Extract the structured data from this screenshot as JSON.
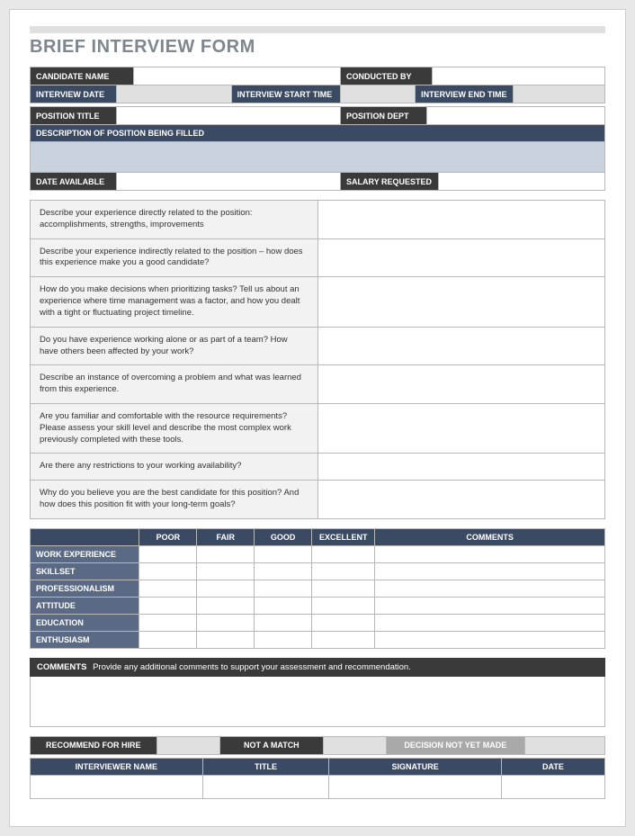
{
  "title": "BRIEF INTERVIEW FORM",
  "header": {
    "candidate_name_label": "CANDIDATE NAME",
    "conducted_by_label": "CONDUCTED BY",
    "interview_date_label": "INTERVIEW DATE",
    "interview_start_label": "INTERVIEW START TIME",
    "interview_end_label": "INTERVIEW END TIME",
    "position_title_label": "POSITION TITLE",
    "position_dept_label": "POSITION DEPT",
    "description_label": "DESCRIPTION OF POSITION BEING FILLED",
    "date_available_label": "DATE AVAILABLE",
    "salary_requested_label": "SALARY REQUESTED"
  },
  "questions": [
    "Describe your experience directly related to the position: accomplishments, strengths, improvements",
    "Describe your experience indirectly related to the position – how does this experience make you a good candidate?",
    "How do you make decisions when prioritizing tasks? Tell us about an experience where time management was a factor, and how you dealt with a tight or fluctuating project timeline.",
    "Do you have experience working alone or as part of a team? How have others been affected by your work?",
    "Describe an instance of overcoming a problem and what was learned from this experience.",
    "Are you familiar and comfortable with the resource requirements? Please assess your skill level and describe the most complex work previously completed with these tools.",
    "Are there any restrictions to your working availability?",
    "Why do you believe you are the best candidate for this position? And how does this position fit with your long-term goals?"
  ],
  "ratings": {
    "columns": [
      "POOR",
      "FAIR",
      "GOOD",
      "EXCELLENT",
      "COMMENTS"
    ],
    "rows": [
      "WORK EXPERIENCE",
      "SKILLSET",
      "PROFESSIONALISM",
      "ATTITUDE",
      "EDUCATION",
      "ENTHUSIASM"
    ]
  },
  "comments": {
    "label": "COMMENTS",
    "text": "Provide any additional comments to support your assessment and recommendation."
  },
  "decision": {
    "recommend_label": "RECOMMEND FOR HIRE",
    "not_match_label": "NOT A MATCH",
    "not_yet_label": "DECISION NOT YET MADE"
  },
  "signature": {
    "interviewer_label": "INTERVIEWER NAME",
    "title_label": "TITLE",
    "signature_label": "SIGNATURE",
    "date_label": "DATE"
  }
}
